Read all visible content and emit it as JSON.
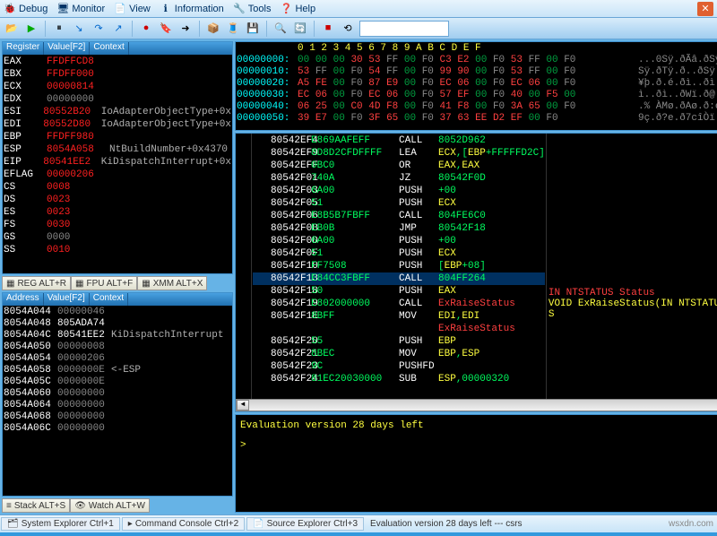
{
  "menu": {
    "items": [
      {
        "icon": "🐞",
        "label": "Debug",
        "u": "D"
      },
      {
        "icon": "🖥",
        "label": "Monitor",
        "u": "M"
      },
      {
        "icon": "📄",
        "label": "View",
        "u": "V"
      },
      {
        "icon": "ℹ",
        "label": "Information",
        "u": "I"
      },
      {
        "icon": "🔧",
        "label": "Tools",
        "u": "T"
      },
      {
        "icon": "❓",
        "label": "Help",
        "u": "H"
      }
    ]
  },
  "registers": {
    "headers": [
      "Register",
      "Value[F2]",
      "Context"
    ],
    "rows": [
      {
        "name": "EAX",
        "val": "FFDFFCD8",
        "cls": "red",
        "ctx": ""
      },
      {
        "name": "EBX",
        "val": "FFDFF000",
        "cls": "red",
        "ctx": ""
      },
      {
        "name": "ECX",
        "val": "00000814",
        "cls": "red",
        "ctx": ""
      },
      {
        "name": "EDX",
        "val": "00000000",
        "cls": "gray",
        "ctx": ""
      },
      {
        "name": "ESI",
        "val": "80552B20",
        "cls": "red",
        "ctx": "IoAdapterObjectType+0x"
      },
      {
        "name": "EDI",
        "val": "80552D80",
        "cls": "red",
        "ctx": "IoAdapterObjectType+0x"
      },
      {
        "name": "EBP",
        "val": "FFDFF980",
        "cls": "red",
        "ctx": ""
      },
      {
        "name": "ESP",
        "val": "8054A058",
        "cls": "red",
        "ctx": "NtBuildNumber+0x4370"
      },
      {
        "name": "EIP",
        "val": "80541EE2",
        "cls": "red",
        "ctx": "KiDispatchInterrupt+0x"
      },
      {
        "name": "EFLAG",
        "val": "00000206",
        "cls": "red",
        "ctx": ""
      },
      {
        "name": "CS",
        "val": "0008",
        "cls": "red",
        "ctx": ""
      },
      {
        "name": "DS",
        "val": "0023",
        "cls": "red",
        "ctx": ""
      },
      {
        "name": "ES",
        "val": "0023",
        "cls": "red",
        "ctx": ""
      },
      {
        "name": "FS",
        "val": "0030",
        "cls": "red",
        "ctx": ""
      },
      {
        "name": "GS",
        "val": "0000",
        "cls": "gray",
        "ctx": ""
      },
      {
        "name": "SS",
        "val": "0010",
        "cls": "red",
        "ctx": ""
      }
    ],
    "tabs": [
      "REG ALT+R",
      "FPU ALT+F",
      "XMM ALT+X"
    ]
  },
  "stack": {
    "headers": [
      "Address",
      "Value[F2]",
      "Context"
    ],
    "rows": [
      {
        "a": "8054A044",
        "v": "00000046",
        "ctx": ""
      },
      {
        "a": "8054A048",
        "v": "805ADA74",
        "ctx": "",
        "w": true
      },
      {
        "a": "8054A04C",
        "v": "80541EE2",
        "ctx": "KiDispatchInterrupt",
        "w": true
      },
      {
        "a": "8054A050",
        "v": "00000008",
        "ctx": ""
      },
      {
        "a": "8054A054",
        "v": "00000206",
        "ctx": ""
      },
      {
        "a": "8054A058",
        "v": "0000000E",
        "ctx": "<-ESP"
      },
      {
        "a": "8054A05C",
        "v": "0000000E",
        "ctx": ""
      },
      {
        "a": "8054A060",
        "v": "00000000",
        "ctx": ""
      },
      {
        "a": "8054A064",
        "v": "00000000",
        "ctx": ""
      },
      {
        "a": "8054A068",
        "v": "00000000",
        "ctx": ""
      },
      {
        "a": "8054A06C",
        "v": "00000000",
        "ctx": ""
      }
    ],
    "tabs": [
      "Stack ALT+S",
      "Watch ALT+W"
    ]
  },
  "hexdump": {
    "header_ruler": "0  1  2  3  4  5  6  7  8  9  A  B  C  D  E  F",
    "rows": [
      {
        "a": "00000000:",
        "b": "00 00 00 30 53 FF 00 F0 C3 E2 00 F0 53 FF 00 F0",
        "asc": "...0Sÿ.ðÃâ.ðSÿ.ð"
      },
      {
        "a": "00000010:",
        "b": "53 FF 00 F0 54 FF 00 F0 99 90 00 F0 53 FF 00 F0",
        "asc": "Sÿ.ðTÿ.ð..ðSÿ.ð"
      },
      {
        "a": "00000020:",
        "b": "A5 FE 00 F0 87 E9 00 F0 EC 06 00 F0 EC 06 00 F0",
        "asc": "¥þ.ð.é.ðì..ðì..ð"
      },
      {
        "a": "00000030:",
        "b": "EC 06 00 F0 EC 06 00 F0 57 EF 00 F0 40 00 F5 00",
        "asc": "ì..ðì..ðWï.ð@.õ."
      },
      {
        "a": "00000040:",
        "b": "06 25 00 C0 4D F8 00 F0 41 F8 00 F0 3A 65 00 F0",
        "asc": ".% ÀMø.ðAø.ð:e.ð"
      },
      {
        "a": "00000050:",
        "b": "39 E7 00 F0 3F 65 00 F0 37 63 EE D2 EF 00 F0",
        "asc": "9ç.ð?e.ð7cîÒï.ð"
      }
    ]
  },
  "disasm": {
    "rows": [
      {
        "a": "80542EF4",
        "b": "E869AAFEFF",
        "m": "CALL",
        "op": "8052D962"
      },
      {
        "a": "80542EF9",
        "b": "8D8D2CFDFFFF",
        "m": "LEA",
        "op": "ECX,[EBP+FFFFFD2C]"
      },
      {
        "a": "80542EFF",
        "b": "0BC0",
        "m": "OR",
        "op": "EAX,EAX"
      },
      {
        "a": "80542F01",
        "b": "740A",
        "m": "JZ",
        "op": "80542F0D"
      },
      {
        "a": "80542F03",
        "b": "6A00",
        "m": "PUSH",
        "op": "+00"
      },
      {
        "a": "80542F05",
        "b": "51",
        "m": "PUSH",
        "op": "ECX"
      },
      {
        "a": "80542F06",
        "b": "E8B5B7FBFF",
        "m": "CALL",
        "op": "804FE6C0"
      },
      {
        "a": "80542F0B",
        "b": "EB0B",
        "m": "JMP",
        "op": "80542F18"
      },
      {
        "a": "80542F0D",
        "b": "6A00",
        "m": "PUSH",
        "op": "+00"
      },
      {
        "a": "80542F0F",
        "b": "51",
        "m": "PUSH",
        "op": "ECX"
      },
      {
        "a": "80542F10",
        "b": "FF7508",
        "m": "PUSH",
        "op": "[EBP+08]"
      },
      {
        "a": "80542F13",
        "b": "E84CC3FBFF",
        "m": "CALL",
        "op": "804FF264",
        "cur": true
      },
      {
        "a": "80542F18",
        "b": "50",
        "m": "PUSH",
        "op": "EAX"
      },
      {
        "a": "80542F19",
        "b": "E802000000",
        "m": "CALL",
        "op": "ExRaiseStatus",
        "red": true
      },
      {
        "a": "80542F1E",
        "b": "8BFF",
        "m": "MOV",
        "op": "EDI,EDI"
      },
      {
        "a": "",
        "b": "",
        "m": "",
        "op": "ExRaiseStatus",
        "sym": true
      },
      {
        "a": "80542F20",
        "b": "55",
        "m": "PUSH",
        "op": "EBP"
      },
      {
        "a": "80542F21",
        "b": "8BEC",
        "m": "MOV",
        "op": "EBP,ESP"
      },
      {
        "a": "80542F23",
        "b": "9C",
        "m": "PUSHFD",
        "op": ""
      },
      {
        "a": "80542F24",
        "b": "81EC20030000",
        "m": "SUB",
        "op": "ESP,00000320"
      }
    ],
    "side": {
      "l1": "IN NTSTATUS Status",
      "l2": "VOID ExRaiseStatus(IN NTSTATUS S"
    }
  },
  "console": {
    "eval_text": "Evaluation version 28 days left",
    "prompt": ">"
  },
  "statusbar": {
    "items": [
      "System Explorer Ctrl+1",
      "Command Console Ctrl+2",
      "Source Explorer Ctrl+3"
    ],
    "eval": "Evaluation version 28 days left --- csrs",
    "watermark": "wsxdn.com"
  }
}
